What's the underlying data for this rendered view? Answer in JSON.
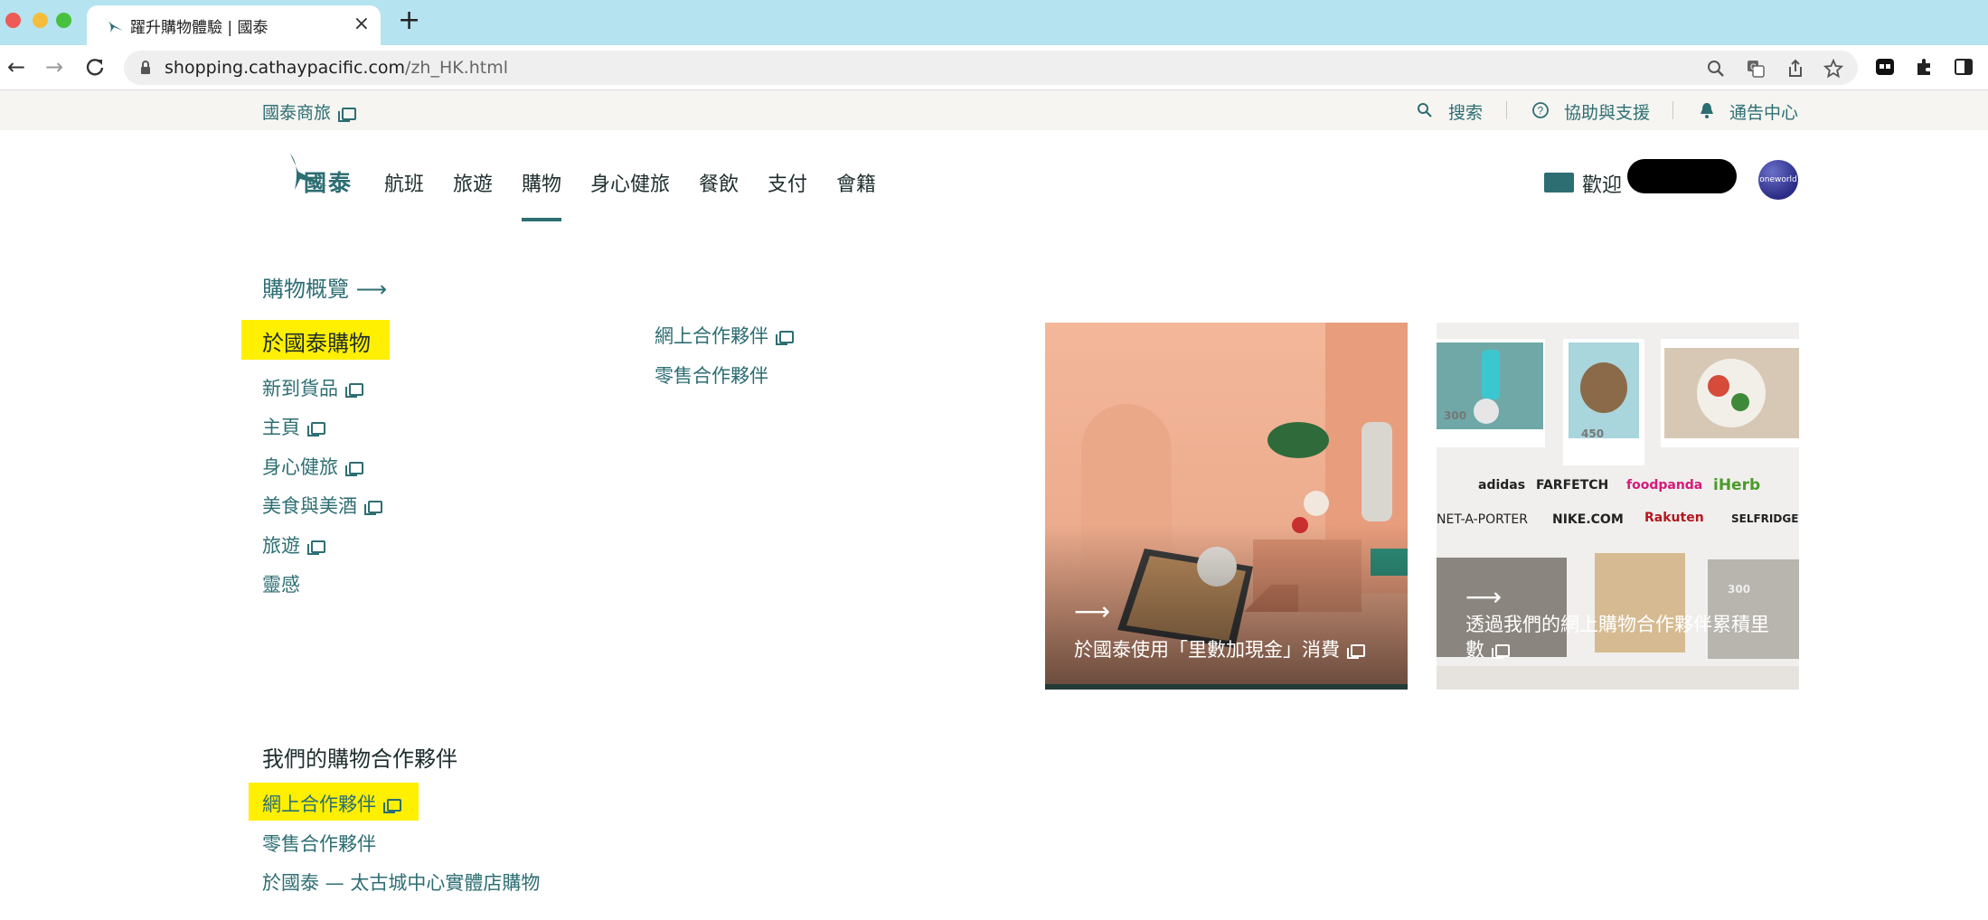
{
  "browser": {
    "tab_title": "躍升購物體驗 | 國泰",
    "url_host": "shopping.cathaypacific.com",
    "url_path": "/zh_HK.html"
  },
  "utility": {
    "left_link": "國泰商旅",
    "search": "搜索",
    "help": "協助與支援",
    "notifications": "通告中心"
  },
  "brand": {
    "logo_text": "國泰"
  },
  "main_nav": {
    "items": [
      "航班",
      "旅遊",
      "購物",
      "身心健旅",
      "餐飲",
      "支付",
      "會籍"
    ],
    "active": "購物",
    "welcome": "歡迎"
  },
  "dropdown": {
    "overview": "購物概覽",
    "col1_heading": "於國泰購物",
    "col1_links": [
      "新到貨品",
      "主頁",
      "身心健旅",
      "美食與美酒",
      "旅遊",
      "靈感"
    ],
    "col2_links": [
      "網上合作夥伴",
      "零售合作夥伴"
    ],
    "partners_heading": "我們的購物合作夥伴",
    "partners_links": [
      "網上合作夥伴",
      "零售合作夥伴",
      "於國泰 — 太古城中心實體店購物"
    ],
    "promo1": {
      "caption": "於國泰使用「里數加現金」消費"
    },
    "promo2": {
      "caption": "透過我們的網上購物合作夥伴累積里數",
      "badges": [
        "300",
        "450",
        "300"
      ],
      "brands_row1": [
        "adidas",
        "FARFETCH",
        "foodpanda",
        "iHerb"
      ],
      "brands_row2": [
        "NET-A-PORTER",
        "NIKE.COM",
        "Rakuten",
        "SELFRIDGES"
      ]
    }
  },
  "colors": {
    "brand_teal": "#2d6e73",
    "highlight": "#ffef00"
  }
}
